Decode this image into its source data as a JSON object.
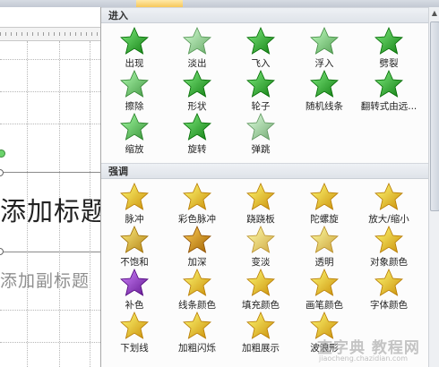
{
  "editor": {
    "title_placeholder": "添加标题",
    "subtitle_placeholder": "添加副标题"
  },
  "gallery": {
    "sections": [
      {
        "label": "进入",
        "items": [
          {
            "label": "出现",
            "icon": "star-icon",
            "color": "#3aa63a"
          },
          {
            "label": "淡出",
            "icon": "star-icon",
            "color": "#8fd18f"
          },
          {
            "label": "飞入",
            "icon": "star-icon",
            "color": "#3aa63a"
          },
          {
            "label": "浮入",
            "icon": "star-icon",
            "color": "#7cc77c"
          },
          {
            "label": "劈裂",
            "icon": "star-icon",
            "color": "#3aa63a"
          },
          {
            "label": "擦除",
            "icon": "star-icon",
            "color": "#6cbf6c"
          },
          {
            "label": "形状",
            "icon": "star-icon",
            "color": "#3aa63a"
          },
          {
            "label": "轮子",
            "icon": "star-icon",
            "color": "#3aa63a"
          },
          {
            "label": "随机线条",
            "icon": "star-icon",
            "color": "#3aa63a"
          },
          {
            "label": "翻转式由远...",
            "icon": "star-icon",
            "color": "#3aa63a"
          },
          {
            "label": "缩放",
            "icon": "star-icon",
            "color": "#5fb85f"
          },
          {
            "label": "旋转",
            "icon": "star-icon",
            "color": "#3aa63a"
          },
          {
            "label": "弹跳",
            "icon": "star-icon",
            "color": "#9ad19a"
          }
        ]
      },
      {
        "label": "强调",
        "items": [
          {
            "label": "脉冲",
            "icon": "star-icon",
            "color": "#f2b630"
          },
          {
            "label": "彩色脉冲",
            "icon": "star-icon",
            "color": "#f2b630"
          },
          {
            "label": "跷跷板",
            "icon": "star-icon",
            "color": "#f2b630"
          },
          {
            "label": "陀螺旋",
            "icon": "star-icon",
            "color": "#f2b630"
          },
          {
            "label": "放大/缩小",
            "icon": "star-icon",
            "color": "#f2b630"
          },
          {
            "label": "不饱和",
            "icon": "star-icon",
            "color": "#d9a93c"
          },
          {
            "label": "加深",
            "icon": "star-icon",
            "color": "#c98a14"
          },
          {
            "label": "变淡",
            "icon": "star-icon",
            "color": "#f7cf6a"
          },
          {
            "label": "透明",
            "icon": "star-icon",
            "color": "#f2c760"
          },
          {
            "label": "对象颜色",
            "icon": "star-icon",
            "color": "#f2b630"
          },
          {
            "label": "补色",
            "icon": "star-icon",
            "color": "#8a3fb8"
          },
          {
            "label": "线条颜色",
            "icon": "star-icon",
            "color": "#f2b630"
          },
          {
            "label": "填充颜色",
            "icon": "star-icon",
            "color": "#f2b630"
          },
          {
            "label": "画笔颜色",
            "icon": "star-icon",
            "color": "#f2b630"
          },
          {
            "label": "字体颜色",
            "icon": "star-icon",
            "color": "#f2b630"
          },
          {
            "label": "下划线",
            "icon": "star-icon",
            "color": "#f2b630"
          },
          {
            "label": "加粗闪烁",
            "icon": "star-icon",
            "color": "#f2b630"
          },
          {
            "label": "加粗展示",
            "icon": "star-icon",
            "color": "#f2b630"
          },
          {
            "label": "波浪形",
            "icon": "star-icon",
            "color": "#f2b630"
          }
        ]
      }
    ]
  },
  "watermark": {
    "main": "查字典 教程网",
    "sub": "jiaocheng.chazidian.com"
  }
}
